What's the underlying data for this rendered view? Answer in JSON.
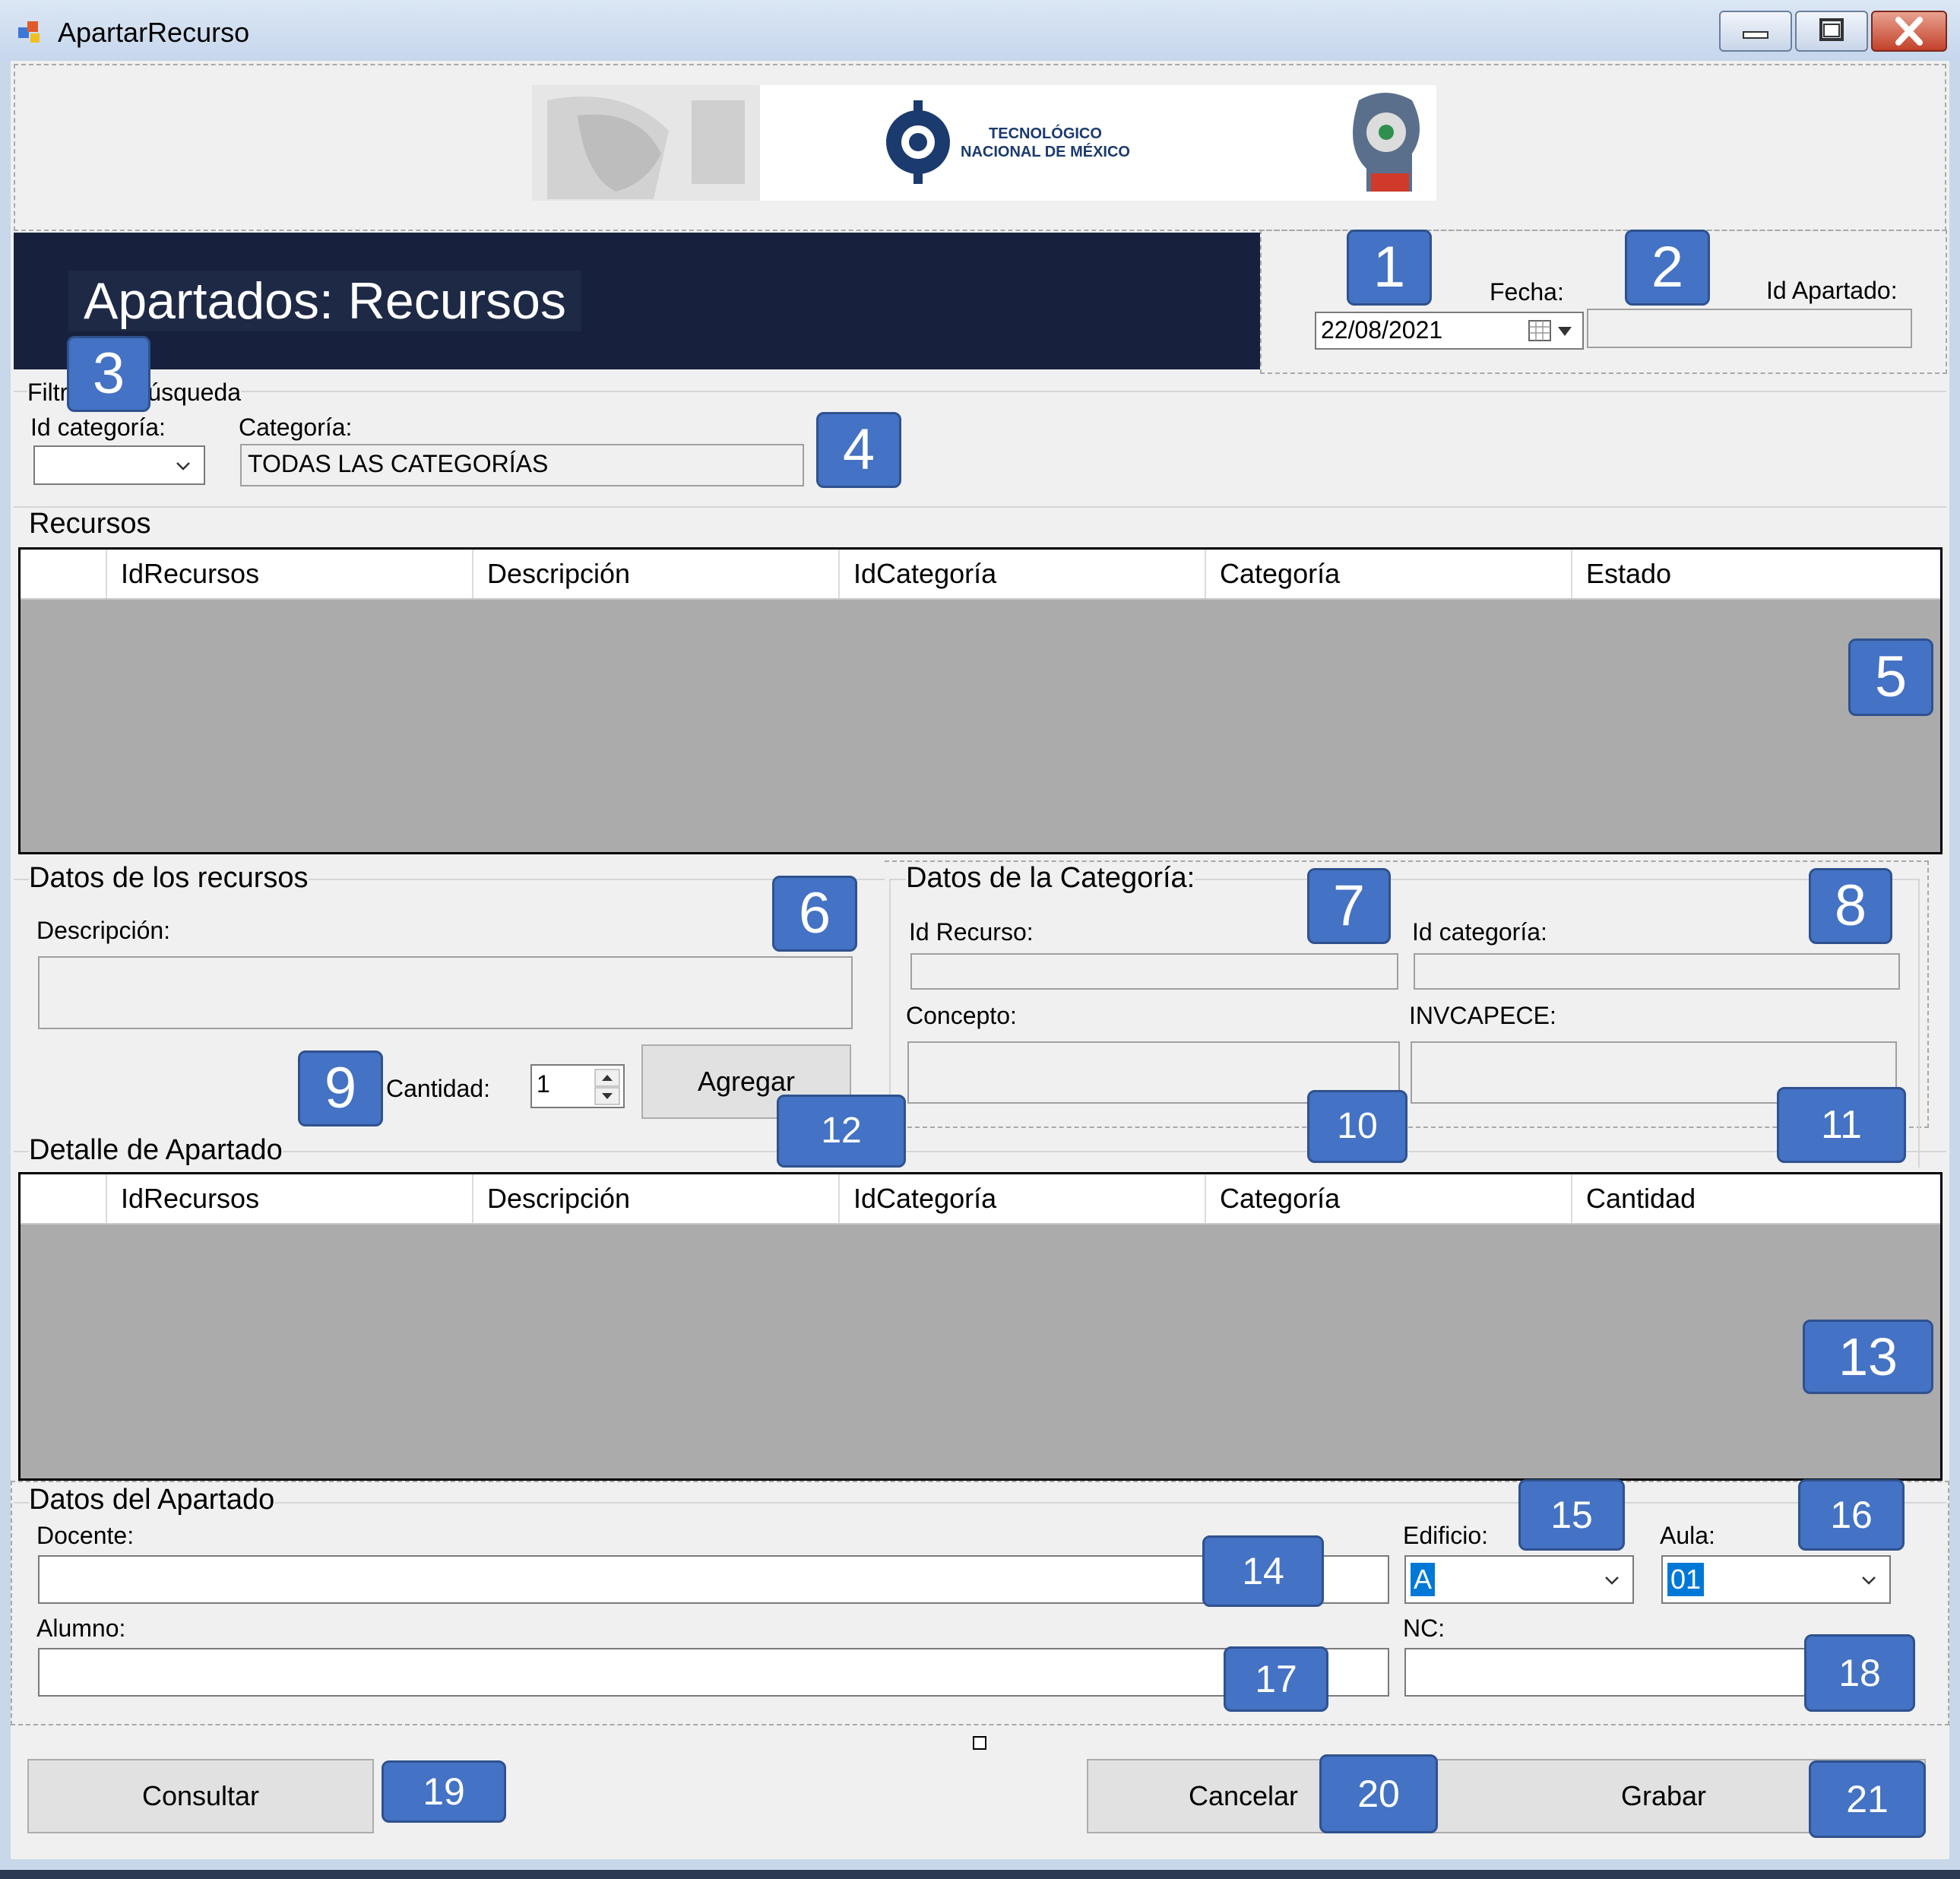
{
  "window": {
    "title": "ApartarRecurso"
  },
  "header": {
    "banner_text_1": "TECNOLÓGICO",
    "banner_text_2": "NACIONAL DE MÉXICO",
    "section_title": "Apartados: Recursos"
  },
  "fecha": {
    "label": "Fecha:",
    "value": "22/08/2021"
  },
  "id_apartado": {
    "label": "Id Apartado:",
    "value": ""
  },
  "filtros": {
    "group_label": "Filtros de búsqueda",
    "id_categoria_label": "Id categoría:",
    "id_categoria_value": "",
    "categoria_label": "Categoría:",
    "categoria_value": "TODAS LAS CATEGORÍAS"
  },
  "recursos": {
    "group_label": "Recursos",
    "columns": [
      "IdRecursos",
      "Descripción",
      "IdCategoría",
      "Categoría",
      "Estado"
    ]
  },
  "datos_recursos": {
    "group_label": "Datos de los recursos",
    "descripcion_label": "Descripción:",
    "cantidad_label": "Cantidad:",
    "cantidad_value": "1",
    "agregar_label": "Agregar"
  },
  "datos_categoria": {
    "group_label": "Datos de la Categoría:",
    "id_recurso_label": "Id Recurso:",
    "id_categoria_label": "Id categoría:",
    "concepto_label": "Concepto:",
    "invcapece_label": "INVCAPECE:"
  },
  "detalle": {
    "group_label": "Detalle de Apartado",
    "columns": [
      "IdRecursos",
      "Descripción",
      "IdCategoría",
      "Categoría",
      "Cantidad"
    ]
  },
  "datos_apartado": {
    "group_label": "Datos del Apartado",
    "docente_label": "Docente:",
    "edificio_label": "Edificio:",
    "edificio_value": "A",
    "aula_label": "Aula:",
    "aula_value": "01",
    "alumno_label": "Alumno:",
    "nc_label": "NC:"
  },
  "buttons": {
    "consultar": "Consultar",
    "cancelar": "Cancelar",
    "grabar": "Grabar"
  },
  "badges": [
    "1",
    "2",
    "3",
    "4",
    "5",
    "6",
    "7",
    "8",
    "9",
    "10",
    "11",
    "12",
    "13",
    "14",
    "15",
    "16",
    "17",
    "18",
    "19",
    "20",
    "21"
  ],
  "colors": {
    "header_navy": "#17213d",
    "badge_blue": "#4472c4",
    "grid_gray": "#ababab",
    "selection_blue": "#0078d7"
  }
}
